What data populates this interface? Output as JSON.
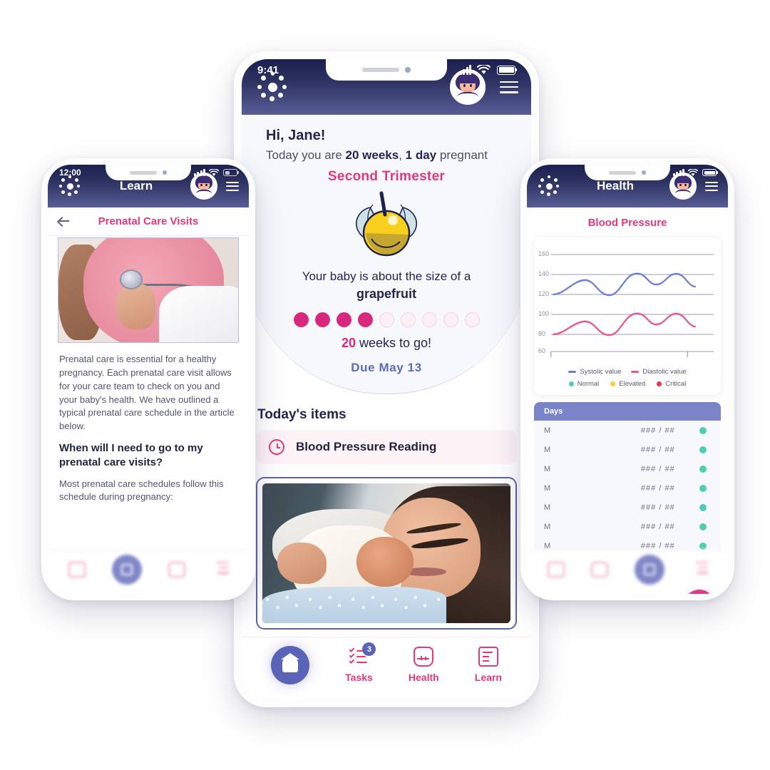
{
  "app": {
    "brand_icon": "sun-dots-logo",
    "accent_pink": "#e2397c",
    "accent_purple": "#5b63b8",
    "header_gradient_from": "#1c2050",
    "header_gradient_to": "#585d96"
  },
  "center_phone": {
    "status": {
      "time": "9:41",
      "signal_icon": "cellular-icon",
      "wifi_icon": "wifi-icon",
      "battery_icon": "battery-icon"
    },
    "header": {
      "avatar_icon": "user-avatar",
      "menu_icon": "hamburger-menu-icon"
    },
    "hero": {
      "greeting": "Hi, Jane!",
      "today_prefix": "Today you are ",
      "weeks": "20 weeks",
      "comma": ", ",
      "days": "1 day",
      "today_suffix": " pregnant",
      "trimester": "Second Trimester",
      "fruit_icon": "grapefruit-illustration",
      "size_text": "Your baby is about the size of a",
      "size_fruit": "grapefruit",
      "progress_filled": 4,
      "progress_total": 9,
      "togo_number": "20",
      "togo_text": " weeks to go!",
      "due_date": "Due May 13"
    },
    "section_title": "Today's items",
    "task": {
      "icon": "clock-icon",
      "label": "Blood Pressure Reading"
    },
    "photo_card": {
      "image_alt": "mother-holding-newborn-photo"
    },
    "tabbar": [
      {
        "key": "home",
        "icon": "home-icon",
        "label": "",
        "active": true,
        "badge": ""
      },
      {
        "key": "tasks",
        "icon": "tasks-icon",
        "label": "Tasks",
        "active": false,
        "badge": "3"
      },
      {
        "key": "health",
        "icon": "health-icon",
        "label": "Health",
        "active": false,
        "badge": ""
      },
      {
        "key": "learn",
        "icon": "learn-icon",
        "label": "Learn",
        "active": false,
        "badge": ""
      }
    ]
  },
  "left_phone": {
    "status": {
      "time": "12:00"
    },
    "header": {
      "title": "Learn",
      "avatar_icon": "user-avatar",
      "menu_icon": "hamburger-menu-icon"
    },
    "subheader": {
      "back_icon": "back-arrow-icon",
      "title": "Prenatal Care Visits"
    },
    "photo": {
      "image_alt": "stethoscope-on-pregnant-belly-photo"
    },
    "article": {
      "p1": "Prenatal care is essential for a healthy pregnancy. Each prenatal care visit allows for your care team to check on you and your baby's health. We have outlined a typical prenatal care schedule in the article below.",
      "h1": "When will I need to go to my prenatal care visits?",
      "p2": "Most prenatal care schedules follow this schedule during pregnancy:"
    },
    "tabbar": [
      {
        "key": "home",
        "icon": "home-icon"
      },
      {
        "key": "learn",
        "icon": "learn-icon",
        "active": true
      },
      {
        "key": "health",
        "icon": "health-icon"
      },
      {
        "key": "tasks",
        "icon": "tasks-icon"
      }
    ]
  },
  "right_phone": {
    "header": {
      "title": "Health",
      "avatar_icon": "user-avatar",
      "menu_icon": "hamburger-menu-icon"
    },
    "subheader": {
      "title": "Blood Pressure"
    },
    "fab": {
      "icon": "plus-icon"
    },
    "table": {
      "columns": [
        "Days",
        ""
      ],
      "rows": [
        {
          "time": "M",
          "value": "### / ##",
          "status": "Normal"
        },
        {
          "time": "M",
          "value": "### / ##",
          "status": "Normal"
        },
        {
          "time": "M",
          "value": "### / ##",
          "status": "Normal"
        },
        {
          "time": "M",
          "value": "### / ##",
          "status": "Normal"
        },
        {
          "time": "M",
          "value": "### / ##",
          "status": "Normal"
        },
        {
          "time": "M",
          "value": "### / ##",
          "status": "Normal"
        },
        {
          "time": "M",
          "value": "### / ##",
          "status": "Normal"
        }
      ]
    }
  },
  "chart_data": {
    "type": "line",
    "title": "Blood Pressure",
    "xlabel": "",
    "ylabel": "",
    "grid": true,
    "legend_position": "bottom",
    "ylim": [
      60,
      160
    ],
    "yticks": [
      60,
      80,
      100,
      120,
      140,
      160
    ],
    "x": [
      0,
      1,
      2,
      3,
      4,
      5,
      6,
      7,
      8,
      9,
      10,
      11
    ],
    "series": [
      {
        "name": "Systolic value",
        "color": "#6b7fd7",
        "values": [
          120,
          123,
          127,
          125,
          121,
          119,
          125,
          132,
          133,
          129,
          132,
          130
        ]
      },
      {
        "name": "Diastolic value",
        "color": "#e8558f",
        "values": [
          80,
          82,
          86,
          85,
          82,
          79,
          85,
          91,
          92,
          88,
          91,
          89
        ]
      }
    ],
    "status_legend": [
      {
        "label": "Normal",
        "color": "#4ecdb4"
      },
      {
        "label": "Elevated",
        "color": "#fcc83c"
      },
      {
        "label": "Critical",
        "color": "#f0334a"
      }
    ]
  }
}
